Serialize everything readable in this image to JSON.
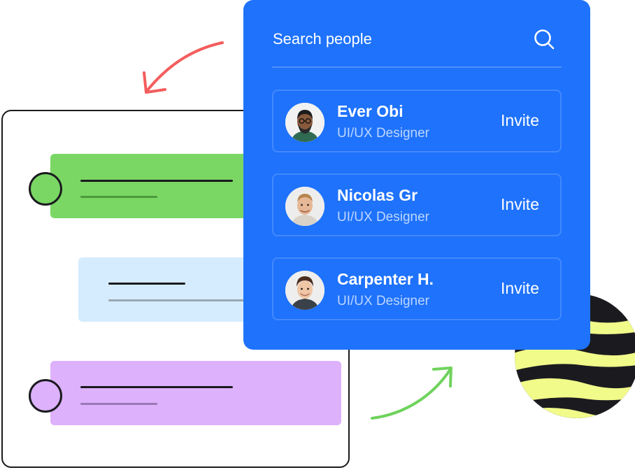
{
  "search": {
    "placeholder": "Search people",
    "icon": "search-icon"
  },
  "people": [
    {
      "name": "Ever Obi",
      "role": "UI/UX Designer",
      "action": "Invite"
    },
    {
      "name": "Nicolas Gr",
      "role": "UI/UX Designer",
      "action": "Invite"
    },
    {
      "name": "Carpenter H.",
      "role": "UI/UX Designer",
      "action": "Invite"
    }
  ],
  "colors": {
    "panel": "#1e72fc",
    "green": "#7ad764",
    "light_blue": "#d4ecfd",
    "purple": "#ddb1fb",
    "arrow_red": "#f45d5d",
    "arrow_green": "#6fd35c",
    "sphere_stripe": "#f1fb8a",
    "ink": "#1b1b1f"
  }
}
